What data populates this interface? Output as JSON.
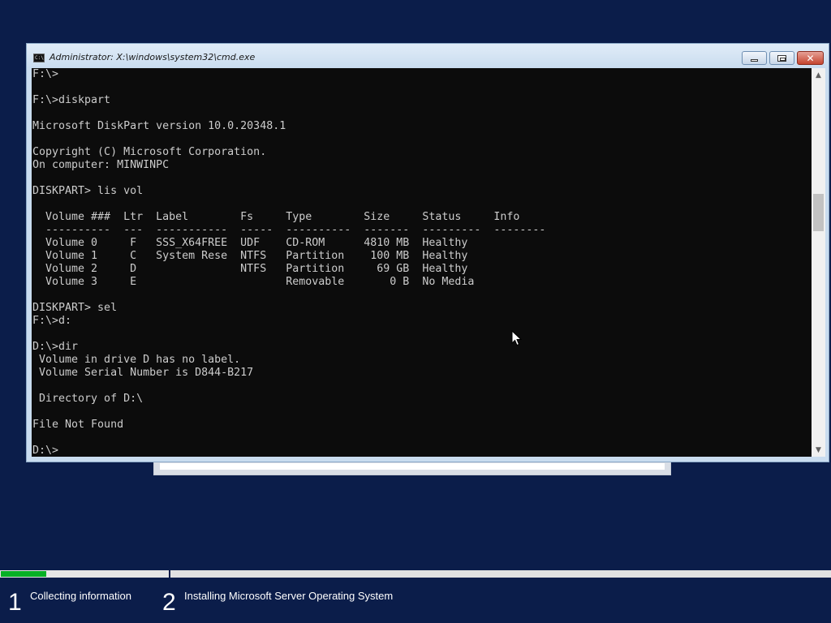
{
  "window": {
    "title": "Administrator: X:\\windows\\system32\\cmd.exe",
    "icon": "cmd-icon",
    "icon_text": "C:\\",
    "minimize_icon": "minimize-icon",
    "maximize_icon": "restore-icon",
    "close_glyph": "✕"
  },
  "console": {
    "lines": [
      "F:\\>",
      "",
      "F:\\>diskpart",
      "",
      "Microsoft DiskPart version 10.0.20348.1",
      "",
      "Copyright (C) Microsoft Corporation.",
      "On computer: MINWINPC",
      "",
      "DISKPART> lis vol",
      "",
      "  Volume ###  Ltr  Label        Fs     Type        Size     Status     Info",
      "  ----------  ---  -----------  -----  ----------  -------  ---------  --------",
      "  Volume 0     F   SSS_X64FREE  UDF    CD-ROM      4810 MB  Healthy",
      "  Volume 1     C   System Rese  NTFS   Partition    100 MB  Healthy",
      "  Volume 2     D                NTFS   Partition     69 GB  Healthy",
      "  Volume 3     E                       Removable       0 B  No Media",
      "",
      "DISKPART> sel",
      "F:\\>d:",
      "",
      "D:\\>dir",
      " Volume in drive D has no label.",
      " Volume Serial Number is D844-B217",
      "",
      " Directory of D:\\",
      "",
      "File Not Found",
      "",
      "D:\\>"
    ]
  },
  "scrollbar": {
    "up_glyph": "▲",
    "down_glyph": "▼"
  },
  "setup": {
    "progress_fraction": 0.27,
    "steps": [
      {
        "number": "1",
        "label": "Collecting information"
      },
      {
        "number": "2",
        "label": "Installing Microsoft Server Operating System"
      }
    ]
  },
  "colors": {
    "desktop_bg": "#0b1d4a",
    "console_bg": "#0c0c0c",
    "console_fg": "#cccccc",
    "progress_green": "#06b025"
  }
}
